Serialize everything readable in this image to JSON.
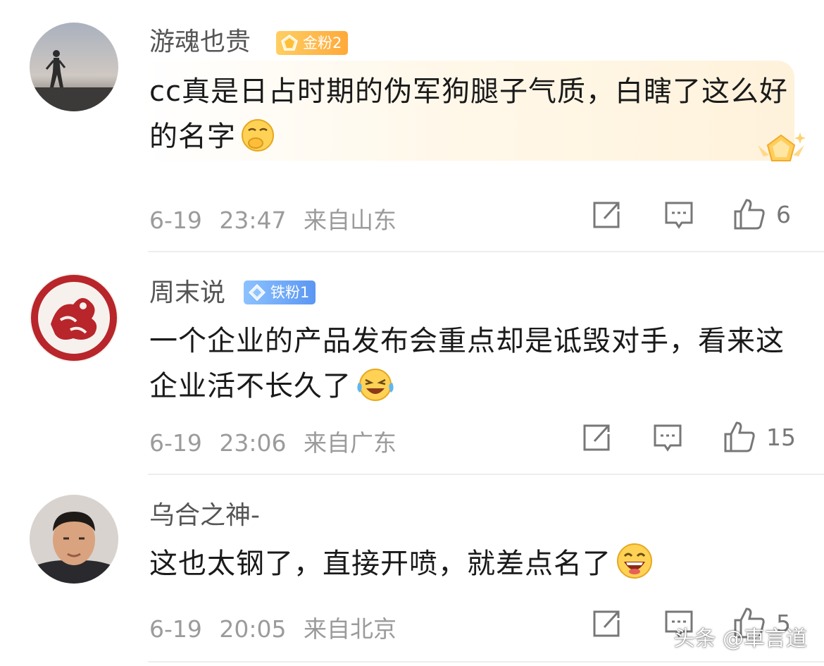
{
  "comments": [
    {
      "username": "游魂也贵",
      "badge": {
        "label": "金粉2",
        "type": "gold",
        "color": "#ffb340",
        "icon": "gold-pentagon-icon"
      },
      "text": "cc真是日占时期的伪军狗腿子气质，白瞎了这么好的名字",
      "emoji": "covering-mouth-emoji",
      "date": "6-19",
      "time": "23:47",
      "location": "来自山东",
      "likes": "6"
    },
    {
      "username": "周末说",
      "badge": {
        "label": "铁粉1",
        "type": "iron",
        "color": "#6aa6f6",
        "icon": "diamond-icon"
      },
      "text": "一个企业的产品发布会重点却是诋毁对手，看来这企业活不长久了",
      "emoji": "laughing-tears-emoji",
      "date": "6-19",
      "time": "23:06",
      "location": "来自广东",
      "likes": "15"
    },
    {
      "username": "乌合之神-",
      "text": "这也太钢了，直接开喷，就差点名了",
      "emoji": "big-grin-emoji",
      "date": "6-19",
      "time": "20:05",
      "location": "来自北京",
      "likes": "5"
    }
  ],
  "watermark": "头条 @車言道",
  "colors": {
    "meta": "#9b9b9b",
    "username": "#555555",
    "text": "#1a1a1a",
    "divider": "#ededed",
    "card_highlight": "#fff4df"
  }
}
